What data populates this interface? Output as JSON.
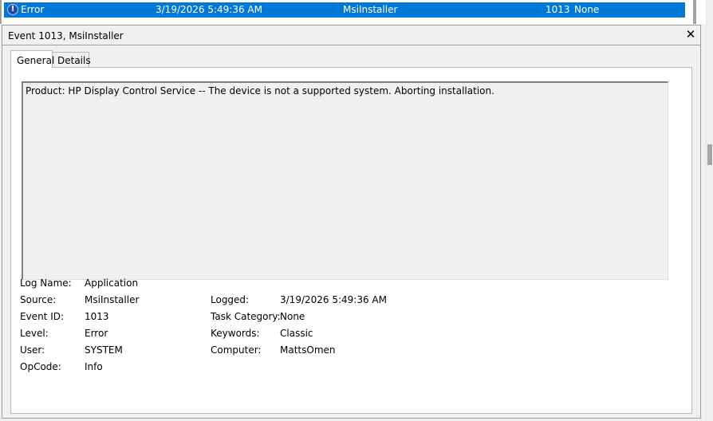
{
  "event_list": {
    "selected_row": {
      "level": "Error",
      "date_time": "3/19/2026 5:49:36 AM",
      "source": "MsiInstaller",
      "event_id": "1013",
      "task_category": "None"
    }
  },
  "detail": {
    "title": "Event 1013, MsiInstaller",
    "close_glyph": "✕",
    "tabs": [
      "General",
      "Details"
    ],
    "message": "Product: HP Display Control Service -- The device is not a supported system. Aborting installation.",
    "fields": {
      "log_name": {
        "label": "Log Name:",
        "value": "Application"
      },
      "source": {
        "label": "Source:",
        "value": "MsiInstaller"
      },
      "event_id": {
        "label": "Event ID:",
        "value": "1013"
      },
      "level": {
        "label": "Level:",
        "value": "Error"
      },
      "user": {
        "label": "User:",
        "value": "SYSTEM"
      },
      "opcode": {
        "label": "OpCode:",
        "value": "Info"
      },
      "logged": {
        "label": "Logged:",
        "value": "3/19/2026 5:49:36 AM"
      },
      "task_category": {
        "label": "Task Category:",
        "value": "None"
      },
      "keywords": {
        "label": "Keywords:",
        "value": "Classic"
      },
      "computer": {
        "label": "Computer:",
        "value": "MattsOmen"
      }
    }
  },
  "icons": {
    "error": "error-icon",
    "close": "close-icon"
  },
  "colors": {
    "selection": "#0078d7",
    "window_bg": "#f0f0f0",
    "error_icon": "#1d4fa8"
  }
}
